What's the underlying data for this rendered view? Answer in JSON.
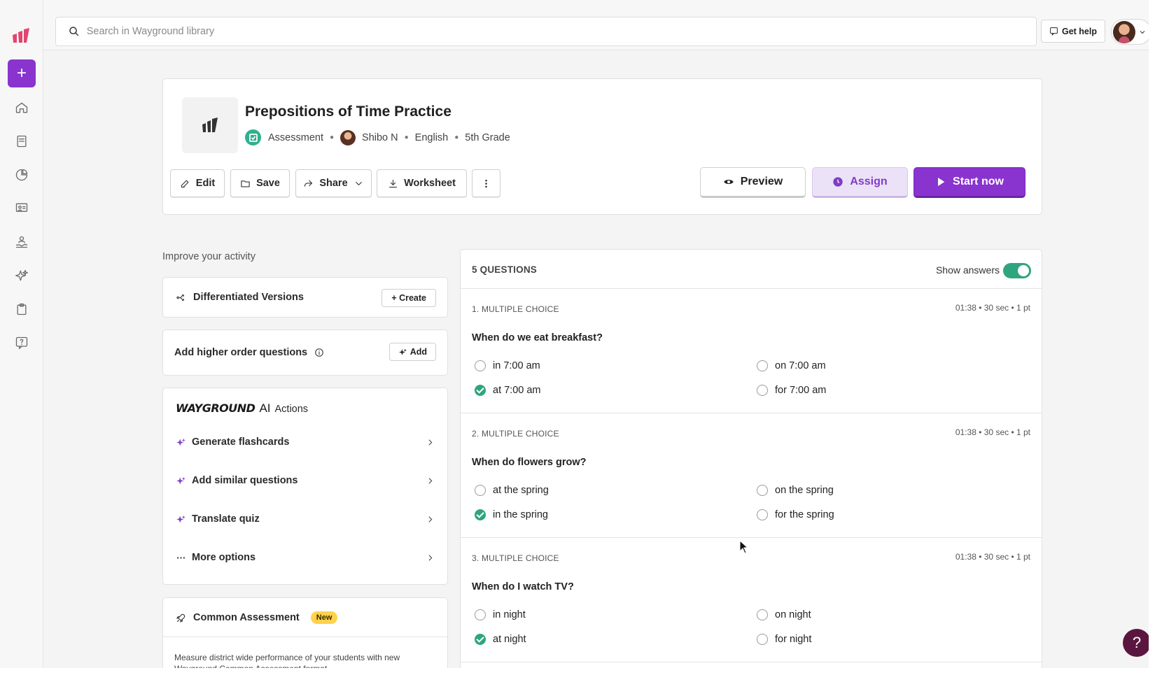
{
  "search": {
    "placeholder": "Search in Wayground library"
  },
  "topbar": {
    "help_label": "Get help"
  },
  "quiz": {
    "title": "Prepositions of Time Practice",
    "type": "Assessment",
    "author": "Shibo N",
    "subject": "English",
    "grade": "5th Grade"
  },
  "toolbar": {
    "edit": "Edit",
    "save": "Save",
    "share": "Share",
    "worksheet": "Worksheet",
    "preview": "Preview",
    "assign": "Assign",
    "start_now": "Start now"
  },
  "left": {
    "improve_label": "Improve your activity",
    "diff_title": "Differentiated Versions",
    "diff_btn": "+ Create",
    "hoq_title": "Add higher order questions",
    "hoq_btn": "Add",
    "ai_brand": "WAYGROUND",
    "ai_ai": "AI",
    "ai_actions": "Actions",
    "ai_items": [
      {
        "label": "Generate flashcards"
      },
      {
        "label": "Add similar questions"
      },
      {
        "label": "Translate quiz"
      },
      {
        "label": "More options"
      }
    ],
    "common_title": "Common Assessment",
    "common_badge": "New",
    "common_desc": "Measure district wide performance of your students with new Wayground Common Assessment format"
  },
  "questions": {
    "count_label": "5 QUESTIONS",
    "show_answers": "Show answers",
    "items": [
      {
        "type": "1. MULTIPLE CHOICE",
        "meta": "01:38  •  30 sec  •  1 pt",
        "text": "When do we eat breakfast?",
        "options": [
          "in 7:00 am",
          "on 7:00 am",
          "at 7:00 am",
          "for 7:00 am"
        ]
      },
      {
        "type": "2. MULTIPLE CHOICE",
        "meta": "01:38  •  30 sec  •  1 pt",
        "text": "When do flowers grow?",
        "options": [
          "at the spring",
          "on the spring",
          "in the spring",
          "for the spring"
        ]
      },
      {
        "type": "3. MULTIPLE CHOICE",
        "meta": "01:38  •  30 sec  •  1 pt",
        "text": "When do I watch TV?",
        "options": [
          "in night",
          "on night",
          "at night",
          "for night"
        ]
      }
    ]
  },
  "colors": {
    "brand_purple": "#8a34cf",
    "correct_green": "#2fa57f",
    "badge_yellow": "#ffd24a"
  },
  "fab": {
    "label": "?"
  }
}
